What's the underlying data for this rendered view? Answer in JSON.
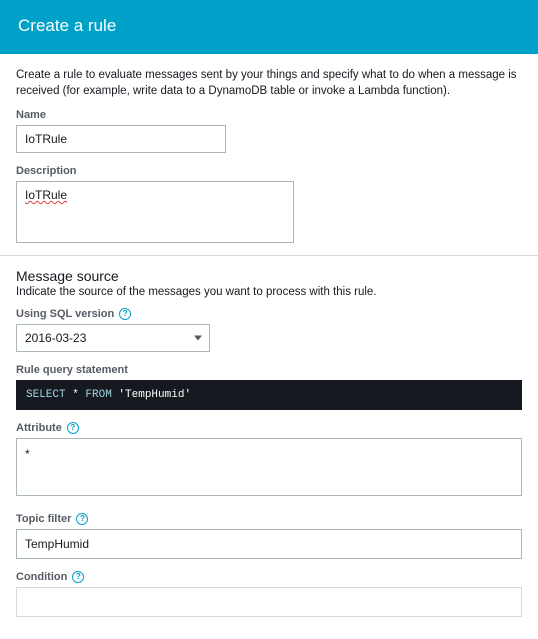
{
  "header": {
    "title": "Create a rule"
  },
  "intro": "Create a rule to evaluate messages sent by your things and specify what to do when a message is received (for example, write data to a DynamoDB table or invoke a Lambda function).",
  "name": {
    "label": "Name",
    "value": "IoTRule"
  },
  "description": {
    "label": "Description",
    "value": "IoTRule"
  },
  "message_source": {
    "title": "Message source",
    "subtitle": "Indicate the source of the messages you want to process with this rule.",
    "sql_version": {
      "label": "Using SQL version",
      "value": "2016-03-23"
    },
    "query": {
      "label": "Rule query statement",
      "kw1": "SELECT",
      "star": " * ",
      "kw2": "FROM",
      "topic": " 'TempHumid'"
    },
    "attribute": {
      "label": "Attribute",
      "value": "*"
    },
    "topic_filter": {
      "label": "Topic filter",
      "value": "TempHumid"
    },
    "condition": {
      "label": "Condition",
      "placeholder": ""
    }
  }
}
